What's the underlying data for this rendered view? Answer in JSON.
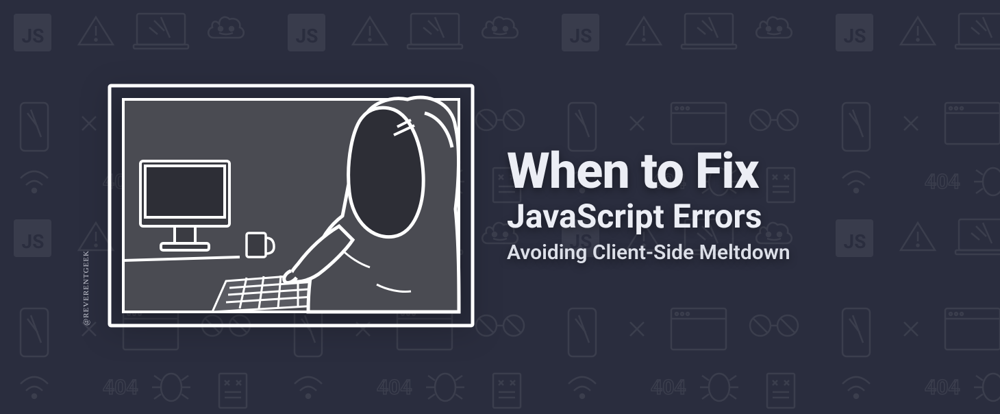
{
  "headline": {
    "title": "When to Fix",
    "subtitle_strong": "JavaScript Errors",
    "subtitle_small": "Avoiding Client-Side Meltdown"
  },
  "illustration": {
    "credit": "@REVERENTGEEK",
    "description": "hooded-figure-at-computer"
  },
  "colors": {
    "background": "#2a2d3e",
    "text": "#e6e8ef",
    "stroke": "#ffffff",
    "fill_dark": "#4a4b52"
  }
}
